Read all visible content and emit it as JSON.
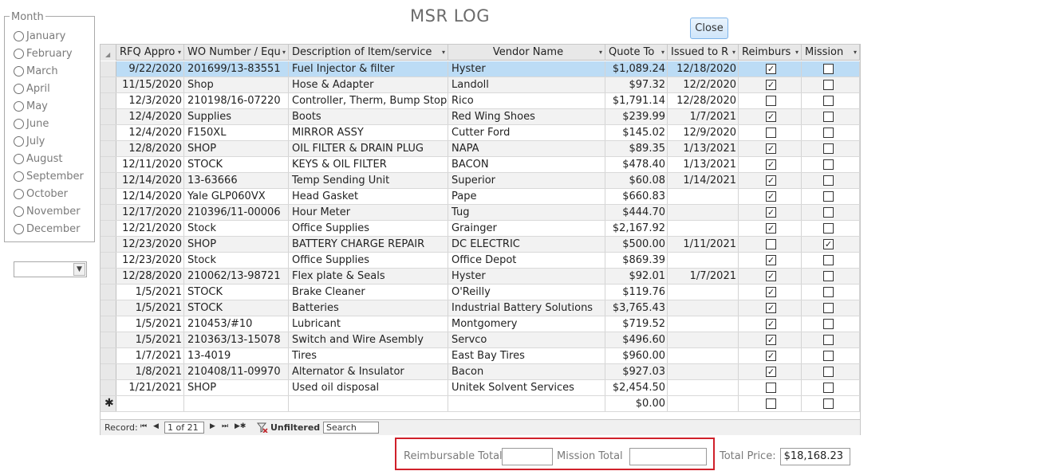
{
  "title": "MSR LOG",
  "close_label": "Close",
  "month_frame": {
    "legend": "Month",
    "options": [
      "January",
      "February",
      "March",
      "April",
      "May",
      "June",
      "July",
      "August",
      "September",
      "October",
      "November",
      "December"
    ],
    "combo_value": ""
  },
  "columns": [
    {
      "label": "RFQ Appro",
      "sort": "▾"
    },
    {
      "label": "WO Number / Equ",
      "sort": "▾"
    },
    {
      "label": "Description of Item/service",
      "sort": "▾"
    },
    {
      "label": "Vendor Name",
      "sort": "▾"
    },
    {
      "label": "Quote To",
      "sort": "▾"
    },
    {
      "label": "Issued to R",
      "sort": "▾"
    },
    {
      "label": "Reimburs",
      "sort": "▾"
    },
    {
      "label": "Mission",
      "sort": "▾"
    }
  ],
  "rows": [
    {
      "date": "9/22/2020",
      "wo": "201699/13-83551",
      "desc": "Fuel Injector & filter",
      "vendor": "Hyster",
      "quote": "$1,089.24",
      "issued": "12/18/2020",
      "reimb": true,
      "mission": false
    },
    {
      "date": "11/15/2020",
      "wo": "Shop",
      "desc": "Hose & Adapter",
      "vendor": "Landoll",
      "quote": "$97.32",
      "issued": "12/2/2020",
      "reimb": true,
      "mission": false
    },
    {
      "date": "12/3/2020",
      "wo": "210198/16-07220",
      "desc": "Controller, Therm, Bump Stop",
      "vendor": "Rico",
      "quote": "$1,791.14",
      "issued": "12/28/2020",
      "reimb": false,
      "mission": false
    },
    {
      "date": "12/4/2020",
      "wo": "Supplies",
      "desc": "Boots",
      "vendor": "Red Wing Shoes",
      "quote": "$239.99",
      "issued": "1/7/2021",
      "reimb": true,
      "mission": false
    },
    {
      "date": "12/4/2020",
      "wo": "F150XL",
      "desc": "MIRROR ASSY",
      "vendor": "Cutter Ford",
      "quote": "$145.02",
      "issued": "12/9/2020",
      "reimb": false,
      "mission": false
    },
    {
      "date": "12/8/2020",
      "wo": "SHOP",
      "desc": "OIL FILTER & DRAIN PLUG",
      "vendor": "NAPA",
      "quote": "$89.35",
      "issued": "1/13/2021",
      "reimb": true,
      "mission": false
    },
    {
      "date": "12/11/2020",
      "wo": "STOCK",
      "desc": "KEYS & OIL FILTER",
      "vendor": "BACON",
      "quote": "$478.40",
      "issued": "1/13/2021",
      "reimb": true,
      "mission": false
    },
    {
      "date": "12/14/2020",
      "wo": "13-63666",
      "desc": "Temp Sending Unit",
      "vendor": "Superior",
      "quote": "$60.08",
      "issued": "1/14/2021",
      "reimb": true,
      "mission": false
    },
    {
      "date": "12/14/2020",
      "wo": "Yale GLP060VX",
      "desc": "Head Gasket",
      "vendor": "Pape",
      "quote": "$660.83",
      "issued": "",
      "reimb": true,
      "mission": false
    },
    {
      "date": "12/17/2020",
      "wo": "210396/11-00006",
      "desc": "Hour Meter",
      "vendor": "Tug",
      "quote": "$444.70",
      "issued": "",
      "reimb": true,
      "mission": false
    },
    {
      "date": "12/21/2020",
      "wo": "Stock",
      "desc": "Office Supplies",
      "vendor": "Grainger",
      "quote": "$2,167.92",
      "issued": "",
      "reimb": true,
      "mission": false
    },
    {
      "date": "12/23/2020",
      "wo": "SHOP",
      "desc": "BATTERY CHARGE REPAIR",
      "vendor": "DC ELECTRIC",
      "quote": "$500.00",
      "issued": "1/11/2021",
      "reimb": false,
      "mission": true
    },
    {
      "date": "12/23/2020",
      "wo": "Stock",
      "desc": "Office Supplies",
      "vendor": "Office Depot",
      "quote": "$869.39",
      "issued": "",
      "reimb": true,
      "mission": false
    },
    {
      "date": "12/28/2020",
      "wo": "210062/13-98721",
      "desc": "Flex plate & Seals",
      "vendor": "Hyster",
      "quote": "$92.01",
      "issued": "1/7/2021",
      "reimb": true,
      "mission": false
    },
    {
      "date": "1/5/2021",
      "wo": "STOCK",
      "desc": "Brake Cleaner",
      "vendor": "O'Reilly",
      "quote": "$119.76",
      "issued": "",
      "reimb": true,
      "mission": false
    },
    {
      "date": "1/5/2021",
      "wo": "STOCK",
      "desc": "Batteries",
      "vendor": "Industrial Battery Solutions",
      "quote": "$3,765.43",
      "issued": "",
      "reimb": true,
      "mission": false
    },
    {
      "date": "1/5/2021",
      "wo": "210453/#10",
      "desc": "Lubricant",
      "vendor": "Montgomery",
      "quote": "$719.52",
      "issued": "",
      "reimb": true,
      "mission": false
    },
    {
      "date": "1/5/2021",
      "wo": "210363/13-15078",
      "desc": "Switch and Wire Asembly",
      "vendor": "Servco",
      "quote": "$496.60",
      "issued": "",
      "reimb": true,
      "mission": false
    },
    {
      "date": "1/7/2021",
      "wo": "13-4019",
      "desc": "Tires",
      "vendor": "East Bay Tires",
      "quote": "$960.00",
      "issued": "",
      "reimb": true,
      "mission": false
    },
    {
      "date": "1/8/2021",
      "wo": "210408/11-09970",
      "desc": "Alternator & Insulator",
      "vendor": "Bacon",
      "quote": "$927.03",
      "issued": "",
      "reimb": true,
      "mission": false
    },
    {
      "date": "1/21/2021",
      "wo": "SHOP",
      "desc": "Used oil disposal",
      "vendor": "Unitek Solvent Services",
      "quote": "$2,454.50",
      "issued": "",
      "reimb": false,
      "mission": false
    }
  ],
  "new_row": {
    "star": "✱",
    "quote": "$0.00"
  },
  "nav": {
    "record_label": "Record:",
    "first": "⏮",
    "prev": "◀",
    "position": "1 of 21",
    "next": "▶",
    "last": "⏭",
    "new": "▶✱",
    "filter_label": "Unfiltered",
    "search": "Search"
  },
  "totals": {
    "reimb_label": "Reimbursable Total",
    "reimb_value": "",
    "mission_label": "Mission Total",
    "mission_value": "",
    "total_label": "Total Price:",
    "total_value": "$18,168.23"
  },
  "colors": {
    "selected_row": "#bcdcf5",
    "highlight_box": "#d0202a",
    "close_button": "#cfe5fa"
  }
}
